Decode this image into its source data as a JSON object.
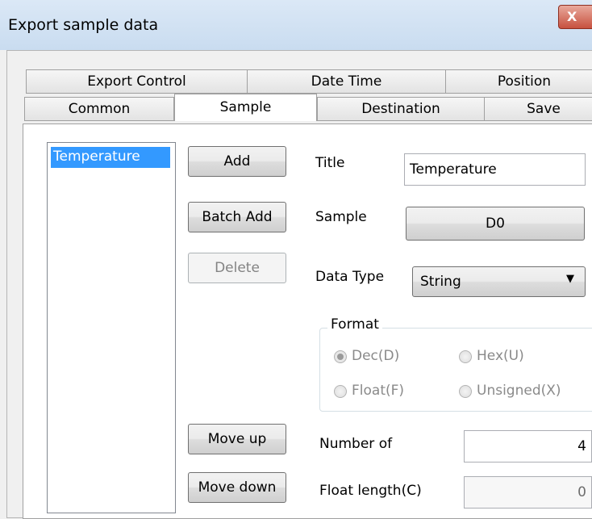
{
  "window": {
    "title": "Export sample data",
    "close_glyph": "X"
  },
  "tabs": {
    "row1": [
      "Export Control",
      "Date Time",
      "Position"
    ],
    "row2": [
      "Common",
      "Sample",
      "Destination",
      "Save"
    ],
    "active": "Sample"
  },
  "sample_list": {
    "items": [
      "Temperature"
    ],
    "selected": "Temperature"
  },
  "buttons": {
    "add": "Add",
    "batch_add": "Batch Add",
    "delete": "Delete",
    "move_up": "Move up",
    "move_down": "Move down"
  },
  "form": {
    "title_label": "Title",
    "title_value": "Temperature",
    "sample_label": "Sample",
    "sample_button": "D0",
    "data_type_label": "Data Type",
    "data_type_value": "String",
    "format_label": "Format",
    "format_options": [
      {
        "label": "Dec(D)",
        "checked": true
      },
      {
        "label": "Hex(U)",
        "checked": false
      },
      {
        "label": "Float(F)",
        "checked": false
      },
      {
        "label": "Unsigned(X)",
        "checked": false
      }
    ],
    "number_of_label": "Number of",
    "number_of_value": "4",
    "float_length_label": "Float length(C)",
    "float_length_value": "0"
  },
  "colors": {
    "selection": "#3399ff",
    "disabled_text": "#8a8a8a"
  }
}
